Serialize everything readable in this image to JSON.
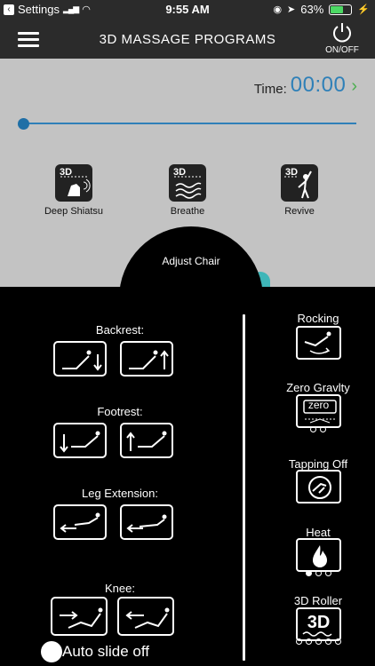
{
  "status_bar": {
    "back_app": "Settings",
    "time": "9:55 AM",
    "battery": "63%",
    "battery_level": 0.63
  },
  "nav": {
    "title": "3D MASSAGE PROGRAMS",
    "power_label": "ON/OFF"
  },
  "timer": {
    "label": "Time:",
    "value": "00:00"
  },
  "programs": [
    {
      "label": "Deep Shiatsu",
      "tag": "3D"
    },
    {
      "label": "Breathe",
      "tag": "3D"
    },
    {
      "label": "Revive",
      "tag": "3D"
    }
  ],
  "adjust_chair": "Adjust Chair",
  "left_controls": {
    "backrest": "Backrest:",
    "footrest": "Footrest:",
    "leg_extension": "Leg Extension:",
    "knee": "Knee:"
  },
  "right_controls": {
    "rocking": "Rocking",
    "zero_gravity": "Zero Gravlty",
    "zero_gravity_btn": "zero",
    "tapping": "Tapping Off",
    "heat": "Heat",
    "roller": "3D Roller",
    "roller_btn": "3D"
  },
  "auto_slide": "Auto slide off"
}
